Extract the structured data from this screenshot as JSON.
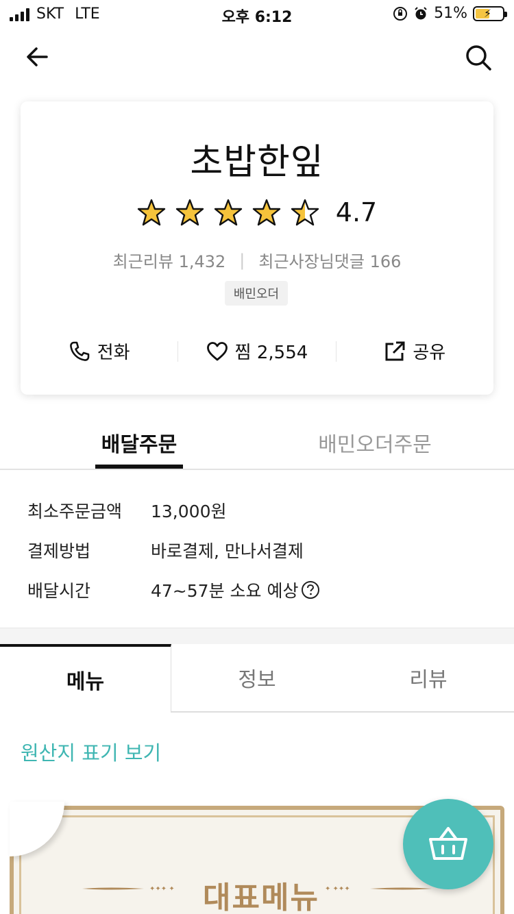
{
  "status_bar": {
    "carrier": "SKT",
    "network": "LTE",
    "time": "오후 6:12",
    "battery": "51%"
  },
  "store": {
    "name": "초밥한잎",
    "rating": "4.7",
    "rating_value": 4.7,
    "recent_reviews": "최근리뷰 1,432",
    "owner_replies": "최근사장님댓글 166",
    "badge": "배민오더",
    "actions": {
      "call": "전화",
      "like": "찜 2,554",
      "share": "공유"
    }
  },
  "order_tabs": {
    "delivery": "배달주문",
    "baemin_order": "배민오더주문"
  },
  "info": [
    {
      "label": "최소주문금액",
      "value": "13,000원"
    },
    {
      "label": "결제방법",
      "value": "바로결제, 만나서결제"
    },
    {
      "label": "배달시간",
      "value": "47~57분 소요 예상"
    }
  ],
  "menu_tabs": {
    "menu": "메뉴",
    "info": "정보",
    "review": "리뷰"
  },
  "origin_link": "원산지 표기 보기",
  "banner_title": "대표메뉴",
  "colors": {
    "accent": "#3fb6b2",
    "fab": "#4fbfb9",
    "banner_gold": "#b08a5a"
  },
  "icons": {
    "back": "back-arrow-icon",
    "search": "search-icon",
    "phone": "phone-icon",
    "heart": "heart-icon",
    "share": "share-icon",
    "cart": "basket-icon",
    "help": "question-circle-icon"
  }
}
